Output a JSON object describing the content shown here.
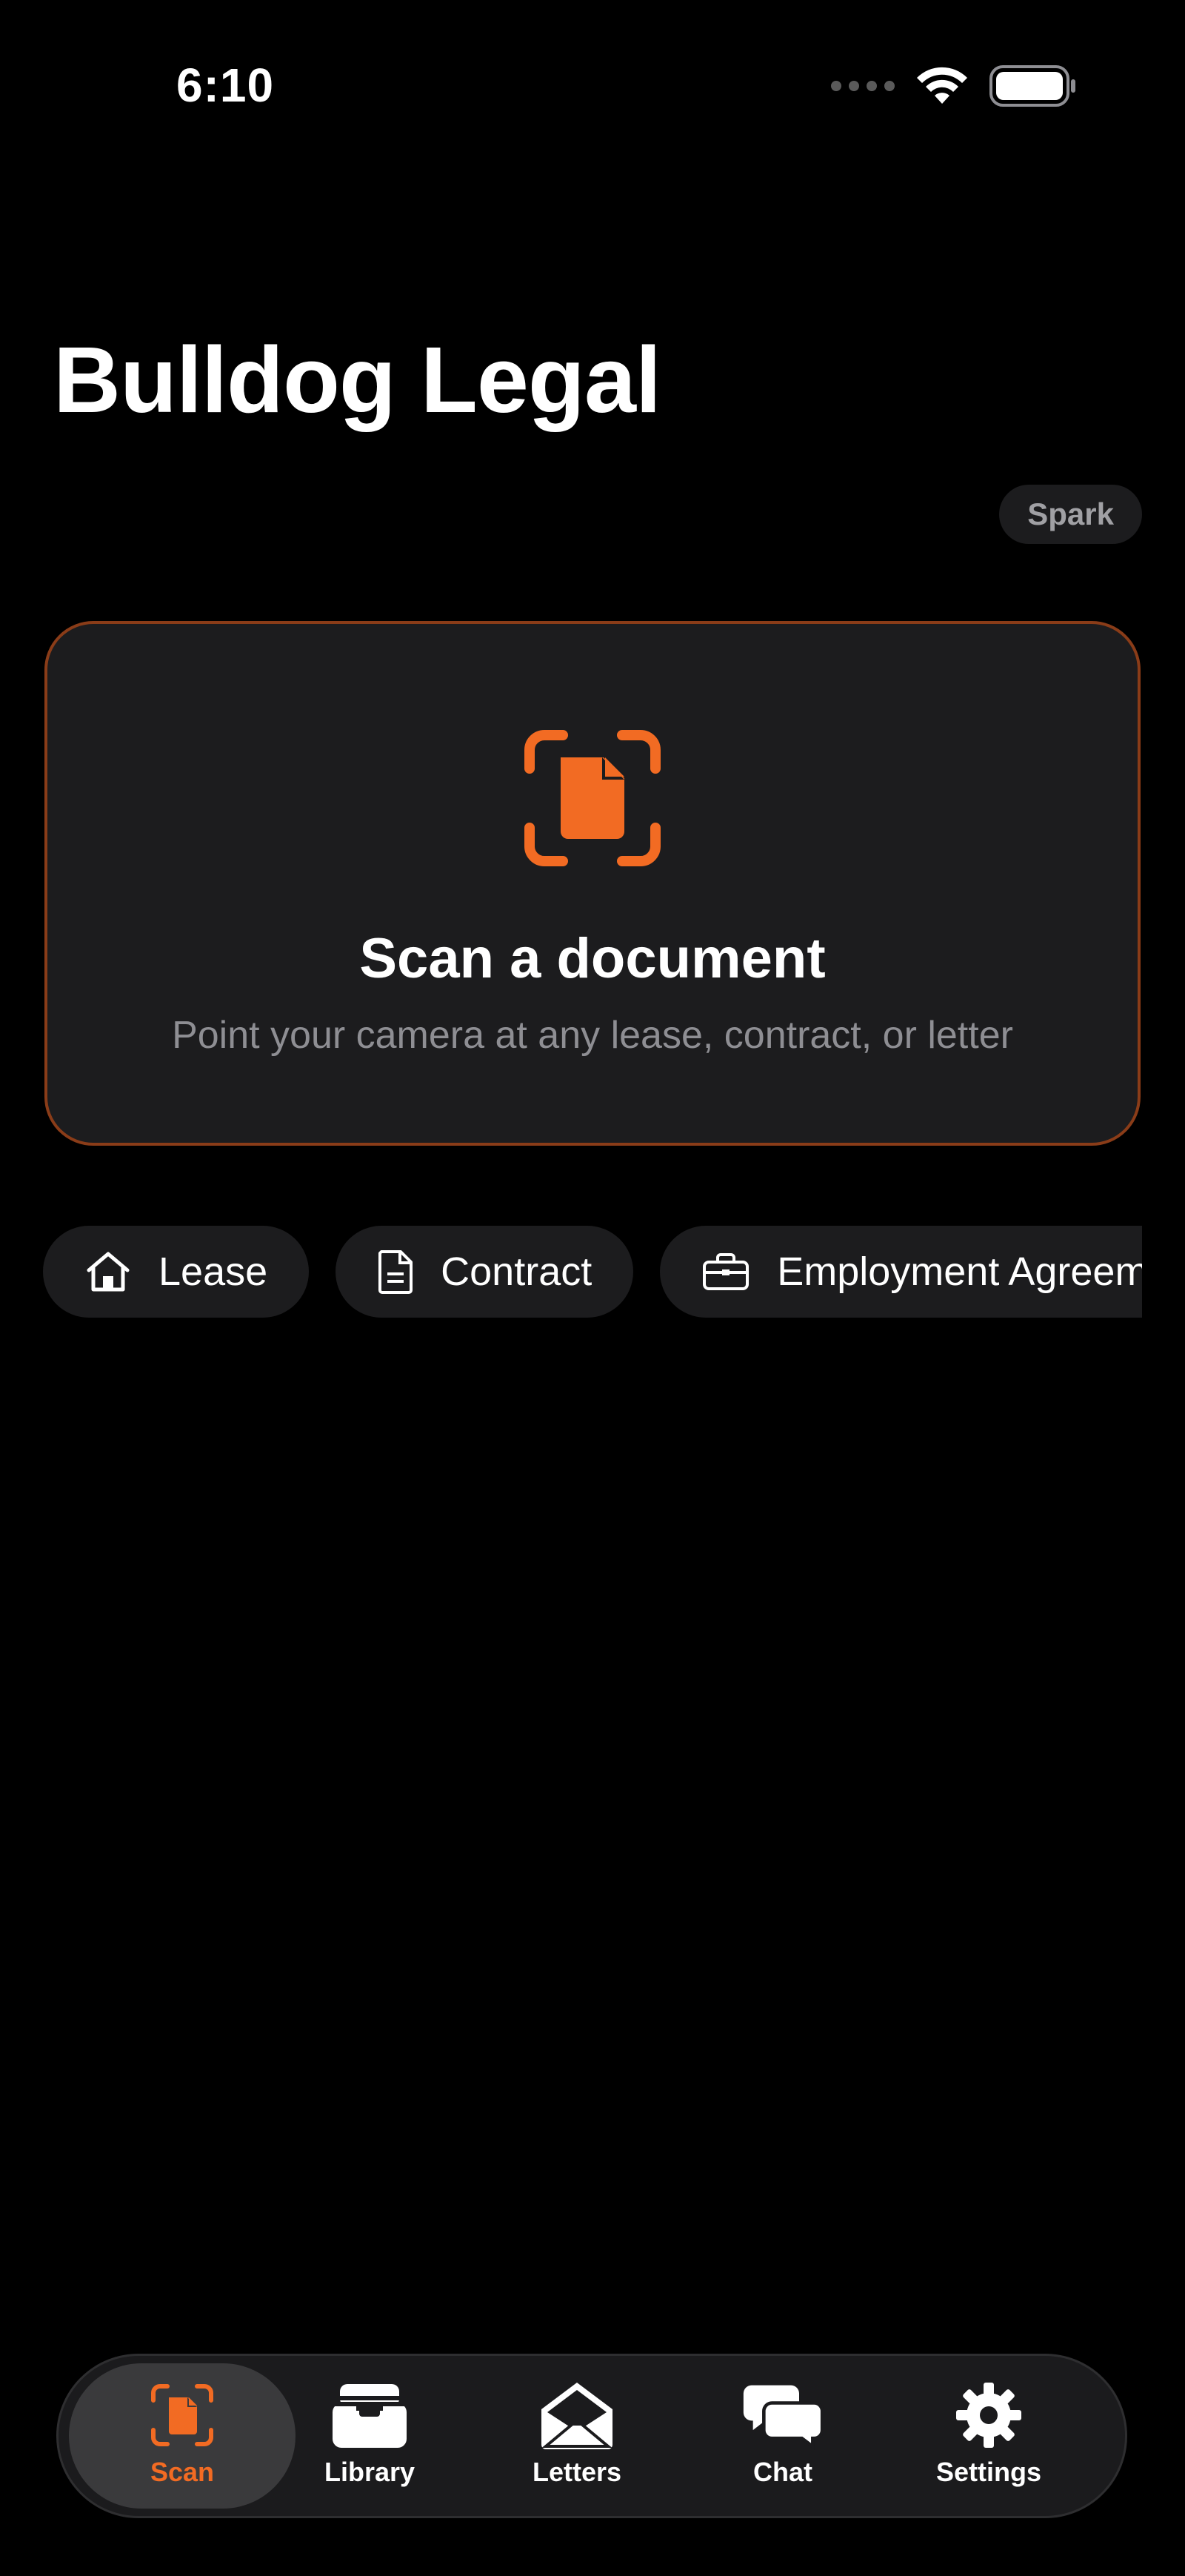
{
  "status_bar": {
    "time": "6:10"
  },
  "header": {
    "title": "Bulldog Legal",
    "plan_badge": "Spark"
  },
  "scan_card": {
    "title": "Scan a document",
    "subtitle": "Point your camera at any lease, contract, or letter",
    "icon": "doc-viewfinder-icon"
  },
  "chips": [
    {
      "label": "Lease",
      "icon": "house-icon"
    },
    {
      "label": "Contract",
      "icon": "document-icon"
    },
    {
      "label": "Employment Agreement",
      "icon": "briefcase-icon"
    }
  ],
  "tabbar": {
    "active": "Scan",
    "tabs": [
      {
        "label": "Scan",
        "icon": "doc-viewfinder-icon"
      },
      {
        "label": "Library",
        "icon": "tray-icon"
      },
      {
        "label": "Letters",
        "icon": "envelope-open-icon"
      },
      {
        "label": "Chat",
        "icon": "chat-bubbles-icon"
      },
      {
        "label": "Settings",
        "icon": "gear-icon"
      }
    ]
  },
  "colors": {
    "accent": "#F26B23",
    "card": "#1C1C1E",
    "background": "#000000",
    "muted_text": "#8E8E93"
  }
}
